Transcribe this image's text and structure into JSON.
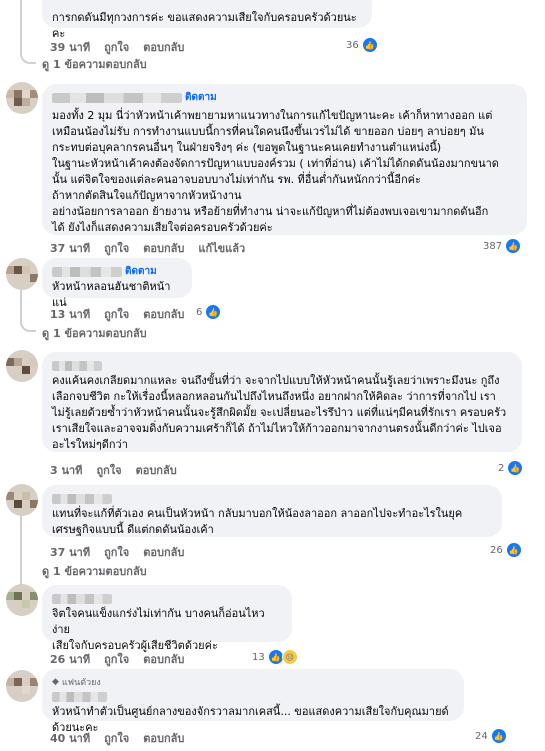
{
  "comments": [
    {
      "id": "c1",
      "text": "การกดดันมีทุกวงการค่ะ ขอแสดงความเสียใจกับครอบครัวด้วยนะคะ",
      "time": "39 นาที",
      "like": "ถูกใจ",
      "reply": "ตอบกลับ",
      "reaction_count": "36",
      "replies_link": "ดู 1 ข้อความตอบกลับ"
    },
    {
      "id": "c2",
      "follow": "ติดตาม",
      "lines": [
        "มองทั้ง 2 มุม นี่ว่าหัวหน้าเค้าพยายามหาแนวทางในการแก้ไขปัญหานะคะ เค้าก็หาทางออก แต่",
        "เหมือนน้องไม่รับ การทำงานแบบนี้การที่คนใดคนนึงขึ้นเวรไม่ได้ ขายออก บ่อยๆ ลาบ่อยๆ มัน",
        "กระทบต่อบุคลากรคนอื่นๆ ในฝ่ายจริงๆ ค่ะ (ขอพูดในฐานะคนเคยทำงานตำแหน่งนี้)",
        "ในฐานะหัวหน้าเค้าคงต้องจัดการปัญหาแบบองค์รวม ( เท่าที่อ่าน) เค้าไม่ได้กดดันน้องมากขนาด",
        "นั้น แต่จิตใจของแต่ละคนอาจบอบบางไม่เท่ากัน รพ. ที่อื่นต่ำกันหนักกว่านี้อีกค่ะ",
        "ถ้าหากตัดสินใจแก้ปัญหาจากหัวหน้างาน",
        "อย่างน้อยการลาออก ย้ายงาน หรือย้ายที่ทำงาน น่าจะแก้ปัญหาที่ไม่ต้องพบเจอเขามากดดันอีก",
        "ได้ ยังไงก็แสดงความเสียใจต่อครอบครัวด้วยค่ะ"
      ],
      "time": "37 นาที",
      "like": "ถูกใจ",
      "reply": "ตอบกลับ",
      "edited": "แก้ไขแล้ว",
      "reaction_count": "387"
    },
    {
      "id": "c3",
      "follow": "ติดตาม",
      "text": "หัวหน้าหลอนฮันชาติหน้าแน่",
      "time": "13 นาที",
      "like": "ถูกใจ",
      "reply": "ตอบกลับ",
      "reaction_count": "6",
      "replies_link": "ดู 1 ข้อความตอบกลับ"
    },
    {
      "id": "c4",
      "lines": [
        "คงแค้นคงเกลียดมากแหละ จนถึงขั้นที่ว่า จะจากไปแบบให้หัวหน้าคนนั้นรู้เลยว่าเพราะมึงนะ กูถึง",
        "เลือกจบชีวิต กะให้เรื่องนี้หลอกหลอนกันไปถึงไหนถึงหนึ่ง อยากฝากให้คิดละ ว่าการที่จากไป เรา",
        "ไม่รู้เลยด้วยซ้ำว่าหัวหน้าคนนั้นจะรู้สึกผิดมั้ย จะเปลี่ยนอะไรรึป่าว แต่ที่แน่ๆมีคนที่รักเรา ครอบครัว",
        "เราเสียใจและอาจจมดิ่งกับความเศร้าก็ได้ ถ้าไม่ไหวให้ก้าวออกมาจากงานตรงนั้นดีกว่าค่ะ ไปเจอ",
        "อะไรใหม่ๆดีกว่า"
      ],
      "time": "3 นาที",
      "like": "ถูกใจ",
      "reply": "ตอบกลับ",
      "reaction_count": "2"
    },
    {
      "id": "c5",
      "lines": [
        "แทนที่จะแก้ที่ตัวเอง คนเป็นหัวหน้า กลับมาบอกให้น้องลาออก ลาออกไปจะทำอะไรในยุค",
        "เศรษฐกิจแบบนี้ ดีแต่กดดันน้องเค้า"
      ],
      "time": "37 นาที",
      "like": "ถูกใจ",
      "reply": "ตอบกลับ",
      "reaction_count": "26",
      "replies_link": "ดู 1 ข้อความตอบกลับ"
    },
    {
      "id": "c6",
      "lines": [
        "จิตใจคนแข็งแกร่งไม่เท่ากัน บางคนก็อ่อนไหวง่าย",
        "เสียใจกับครอบครัวผู้เสียชีวิตด้วยค่ะ"
      ],
      "time": "26 นาที",
      "like": "ถูกใจ",
      "reply": "ตอบกลับ",
      "reaction_count": "13"
    },
    {
      "id": "c7",
      "badge": "แฟนตัวยง",
      "text": "หัวหน้าทำตัวเป็นศูนย์กลางของจักรวาลมากเคสนี้... ขอแสดงความเสียใจกับคุณมายด์ด้วยนะคะ",
      "time": "40 นาที",
      "like": "ถูกใจ",
      "reply": "ตอบกลับ",
      "reaction_count": "24"
    }
  ],
  "icons": {
    "like_reaction": "like-icon",
    "sad_reaction": "sad-icon",
    "reply_arrow": "reply-arrow-icon",
    "fan_badge": "fan-badge-icon"
  },
  "colors": {
    "accent": "#0866ff",
    "bubble": "#f0f2f5",
    "meta": "#65676b",
    "like": "#1877f2"
  }
}
